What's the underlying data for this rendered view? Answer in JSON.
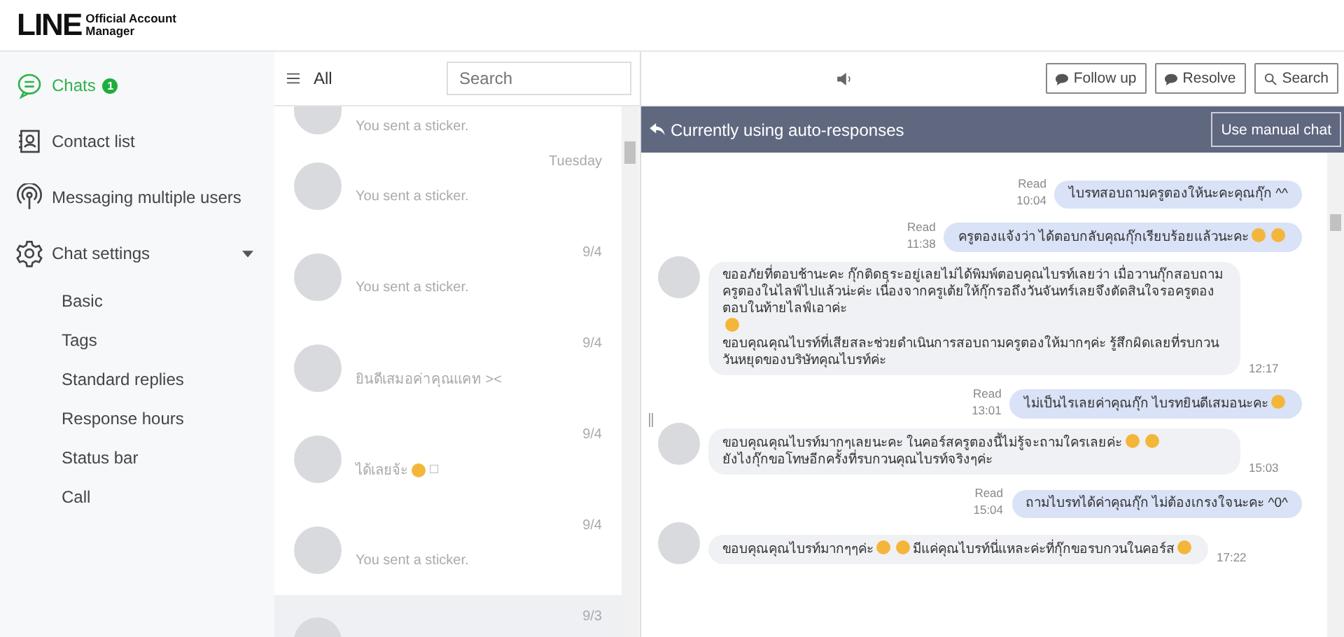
{
  "header": {
    "logo": "LINE",
    "product_lines": [
      "Official Account",
      "Manager"
    ]
  },
  "sidebar": {
    "items": [
      {
        "label": "Chats",
        "selected": true,
        "badge": "1"
      },
      {
        "label": "Contact list",
        "selected": false
      },
      {
        "label": "Messaging multiple users",
        "selected": false
      },
      {
        "label": "Chat settings",
        "selected": false,
        "expanded": true,
        "children": [
          {
            "label": "Basic"
          },
          {
            "label": "Tags"
          },
          {
            "label": "Standard replies"
          },
          {
            "label": "Response hours"
          },
          {
            "label": "Status bar"
          },
          {
            "label": "Call"
          }
        ]
      }
    ]
  },
  "chat_list": {
    "filter": "All",
    "search": {
      "placeholder": "Search"
    },
    "items": [
      {
        "preview": [
          {
            "kind": "text",
            "text": "You sent a sticker."
          }
        ],
        "selected": false
      },
      {
        "date": "Tuesday",
        "preview": [
          {
            "kind": "text",
            "text": "You sent a sticker."
          }
        ],
        "selected": false
      },
      {
        "date": "9/4",
        "preview": [
          {
            "kind": "text",
            "text": "You sent a sticker."
          }
        ],
        "selected": false
      },
      {
        "date": "9/4",
        "preview": [
          {
            "kind": "text",
            "text": "ยินดีเสมอค่าคุณแคท ><"
          }
        ],
        "selected": false
      },
      {
        "date": "9/4",
        "preview": [
          {
            "kind": "text",
            "text": "ได้เลยจ้ะ"
          },
          {
            "kind": "emoji"
          },
          {
            "kind": "text",
            "text": "□"
          }
        ],
        "selected": false
      },
      {
        "date": "9/4",
        "preview": [
          {
            "kind": "text",
            "text": "You sent a sticker."
          }
        ],
        "selected": false
      },
      {
        "date": "9/3",
        "selected": true
      }
    ]
  },
  "chat": {
    "buttons": [
      {
        "label": "Follow up"
      },
      {
        "label": "Resolve"
      },
      {
        "label": "Search"
      }
    ],
    "banner": {
      "text": "Currently using auto-responses",
      "button": "Use manual chat"
    },
    "messages": [
      {
        "kind": "out",
        "read": "Read",
        "time": "10:04",
        "parts": [
          {
            "kind": "text",
            "text": "ไบรทสอบถามครูตองให้นะคะคุณกุ๊ก ^^"
          }
        ]
      },
      {
        "kind": "out",
        "read": "Read",
        "time": "11:38",
        "parts": [
          {
            "kind": "text",
            "text": "ครูตองแจ้งว่า ได้ตอบกลับคุณกุ๊กเรียบร้อยแล้วนะคะ"
          },
          {
            "kind": "emoji"
          },
          {
            "kind": "emoji"
          }
        ]
      },
      {
        "kind": "in",
        "time": "12:17",
        "parts": [
          {
            "kind": "text",
            "text": "ขออภัยที่ตอบช้านะคะ กุ๊กติดธุระอยู่เลยไม่ได้พิมพ์ตอบคุณไบรท์เลยว่า เมื่อวานกุ๊กสอบถามครูตองในไลฟ์ไปแล้วน่ะค่ะ เนื่องจากครูเต้ยให้กุ๊กรอถึงวันจันทร์เลยจึงตัดสินใจรอครูตองตอบในท้ายไลฟ์เอาค่ะ"
          },
          {
            "kind": "emoji"
          },
          {
            "kind": "text",
            "text": "ขอบคุณคุณไบรท์ที่เสียสละช่วยดำเนินการสอบถามครูตองให้มากๆค่ะ รู้สึกผิดเลยที่รบกวนวันหยุดของบริษัทคุณไบรท์ค่ะ"
          }
        ]
      },
      {
        "kind": "out",
        "read": "Read",
        "time": "13:01",
        "parts": [
          {
            "kind": "text",
            "text": "ไม่เป็นไรเลยค่าคุณกุ๊ก ไบรทยินดีเสมอนะคะ"
          },
          {
            "kind": "emoji"
          }
        ]
      },
      {
        "kind": "in",
        "time": "15:03",
        "parts": [
          {
            "kind": "text",
            "text": "ขอบคุณคุณไบรท์มากๆเลยนะคะ ในคอร์สครูตองนี้ไม่รู้จะถามใครเลยค่ะ"
          },
          {
            "kind": "emoji"
          },
          {
            "kind": "emoji"
          },
          {
            "kind": "text",
            "text": "ยังไงกุ๊กขอโทษอีกครั้งที่รบกวนคุณไบรท์จริงๆค่ะ"
          }
        ]
      },
      {
        "kind": "out",
        "read": "Read",
        "time": "15:04",
        "parts": [
          {
            "kind": "text",
            "text": "ถามไบรทได้ค่าคุณกุ๊ก ไม่ต้องเกรงใจนะคะ ^0^"
          }
        ]
      },
      {
        "kind": "in",
        "time": "17:22",
        "parts": [
          {
            "kind": "text",
            "text": "ขอบคุณคุณไบรท์มากๆๆค่ะ"
          },
          {
            "kind": "emoji"
          },
          {
            "kind": "emoji"
          },
          {
            "kind": "text",
            "text": "มีแค่คุณไบรท์นี่แหละค่ะที่กุ๊กขอรบกวนในคอร์ส"
          },
          {
            "kind": "emoji"
          }
        ]
      }
    ]
  }
}
